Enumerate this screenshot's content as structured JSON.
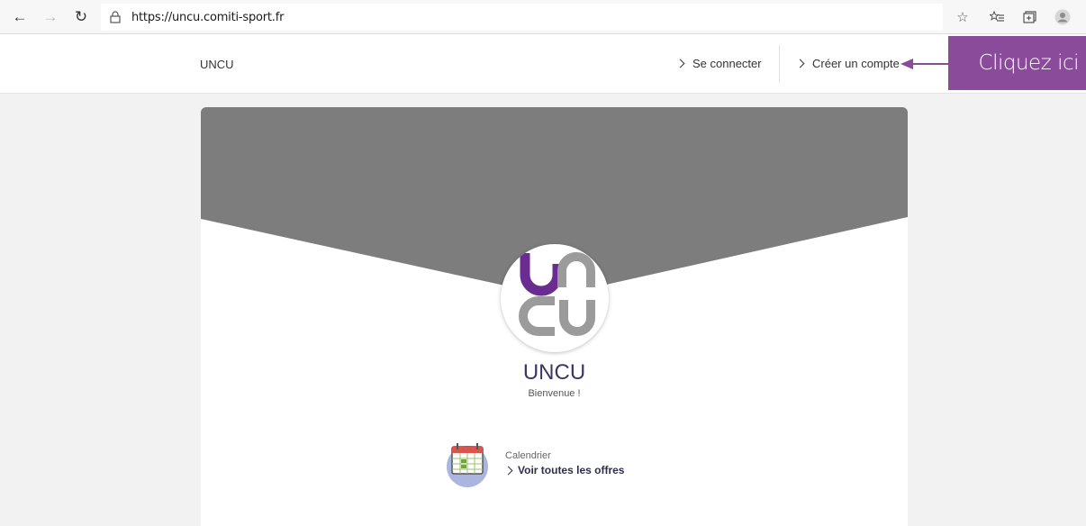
{
  "browser": {
    "url": "https://uncu.comiti-sport.fr",
    "back_icon": "←",
    "forward_icon": "→",
    "refresh_icon": "↻",
    "star_icon": "☆",
    "favorites_icon": "★",
    "collections_icon": "⊞",
    "profile_icon": "●"
  },
  "header": {
    "brand": "UNCU",
    "login_label": "Se connecter",
    "signup_label": "Créer un compte"
  },
  "annotation": {
    "text": "Cliquez ici",
    "color": "#8a4b9a"
  },
  "club": {
    "name": "UNCU",
    "welcome": "Bienvenue !",
    "logo_colors": {
      "purple": "#6a2c91",
      "grey": "#9b9b9b"
    },
    "banner_color": "#7d7d7d"
  },
  "calendar": {
    "label": "Calendrier",
    "link_label": "Voir toutes les offres"
  }
}
